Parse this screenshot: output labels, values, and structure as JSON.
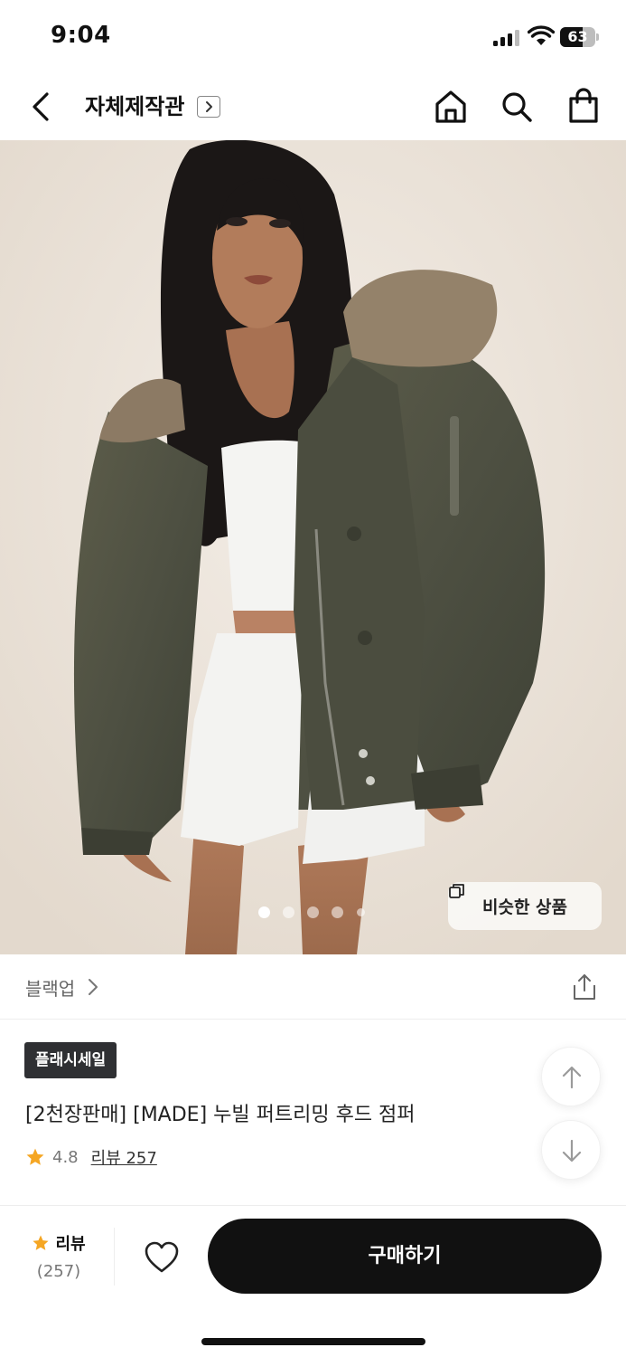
{
  "status_bar": {
    "time": "9:04",
    "battery_level": "63",
    "battery_fraction": 0.63,
    "icons": [
      "signal-icon",
      "wifi-icon",
      "battery-icon"
    ]
  },
  "header": {
    "store_title": "자체제작관",
    "icons": [
      "back-arrow-icon",
      "chevron-right-icon",
      "home-icon",
      "search-icon",
      "shopping-bag-icon"
    ]
  },
  "gallery": {
    "similar_button_label": "비슷한 상품",
    "current_index": 1,
    "total_images": 5,
    "icons": [
      "copy-icon"
    ]
  },
  "brand": {
    "name": "블랙업",
    "icons": [
      "chevron-right-icon",
      "share-icon"
    ]
  },
  "product": {
    "badge": "플래시세일",
    "title": "[2천장판매] [MADE] 누빌 퍼트리밍 후드 점퍼",
    "rating": "4.8",
    "review_link": "리뷰 257",
    "icons": [
      "star-icon",
      "arrow-up-icon",
      "arrow-down-icon"
    ]
  },
  "bottom_bar": {
    "review_label": "리뷰",
    "review_count": "(257)",
    "buy_label": "구매하기",
    "icons": [
      "star-icon",
      "heart-icon"
    ]
  },
  "colors": {
    "star": "#f5a623",
    "buy_button": "#111111",
    "badge": "#2f3033"
  }
}
